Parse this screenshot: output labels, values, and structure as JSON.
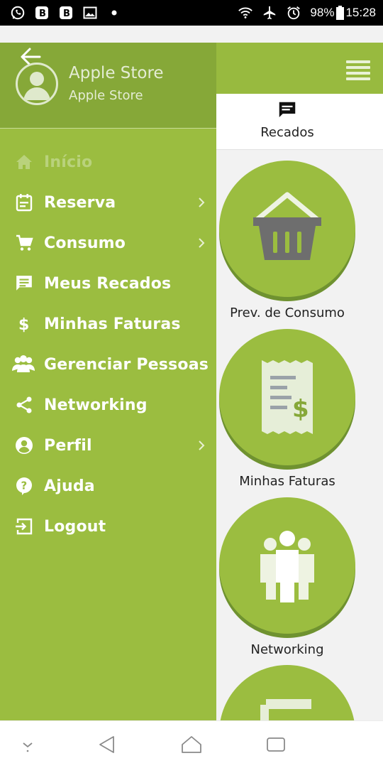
{
  "status_bar": {
    "icons_left": [
      "whatsapp-icon",
      "b-app-icon",
      "b-app-icon",
      "gallery-icon",
      "dot-icon"
    ],
    "icons_right": [
      "wifi-icon",
      "airplane-icon",
      "alarm-icon",
      "battery-icon"
    ],
    "battery": "98%",
    "time": "15:28"
  },
  "drawer": {
    "user": {
      "name": "Apple Store",
      "subtitle": "Apple Store"
    },
    "items": [
      {
        "label": "Início",
        "icon": "home-icon",
        "has_submenu": false,
        "disabled": true
      },
      {
        "label": "Reserva",
        "icon": "calendar-icon",
        "has_submenu": true
      },
      {
        "label": "Consumo",
        "icon": "cart-icon",
        "has_submenu": true
      },
      {
        "label": "Meus Recados",
        "icon": "message-icon",
        "has_submenu": false
      },
      {
        "label": "Minhas Faturas",
        "icon": "dollar-icon",
        "has_submenu": false
      },
      {
        "label": "Gerenciar Pessoas",
        "icon": "people-icon",
        "has_submenu": false
      },
      {
        "label": "Networking",
        "icon": "share-icon",
        "has_submenu": false
      },
      {
        "label": "Perfil",
        "icon": "account-circle-icon",
        "has_submenu": true
      },
      {
        "label": "Ajuda",
        "icon": "help-icon",
        "has_submenu": false
      },
      {
        "label": "Logout",
        "icon": "logout-icon",
        "has_submenu": false
      }
    ]
  },
  "main": {
    "top_tab": {
      "label": "Recados",
      "icon": "message-icon"
    },
    "tiles": [
      {
        "label": "Prev. de Consumo",
        "icon": "basket-icon"
      },
      {
        "label": "Minhas Faturas",
        "icon": "invoice-icon"
      },
      {
        "label": "Networking",
        "icon": "group-icon"
      },
      {
        "label": "",
        "icon": "document-icon"
      }
    ]
  },
  "colors": {
    "accent": "#9bbd40",
    "accent_dark": "#86a838",
    "text_light": "#ffffff"
  }
}
